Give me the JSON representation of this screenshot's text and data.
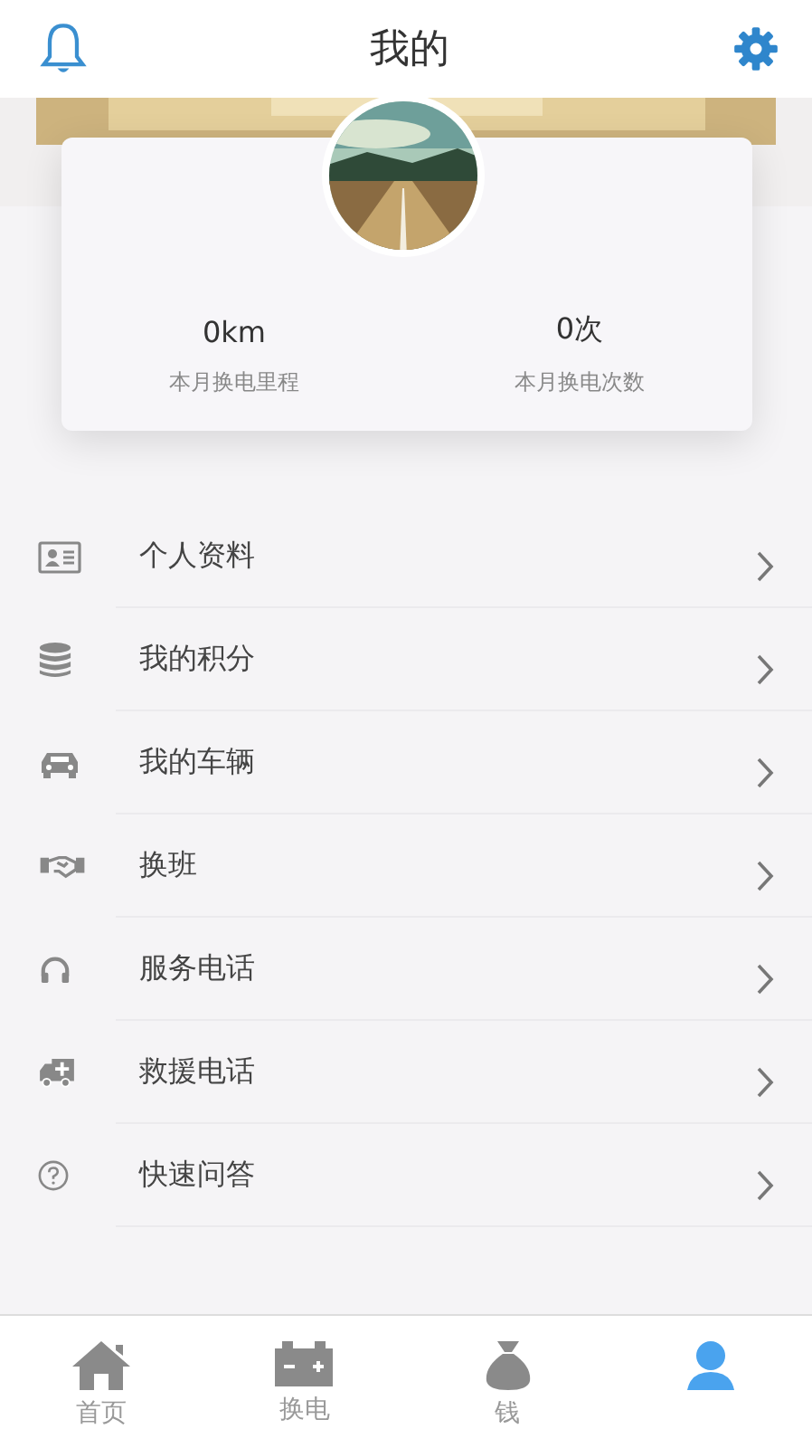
{
  "header": {
    "title": "我的"
  },
  "stats": [
    {
      "value": "0km",
      "label": "本月换电里程"
    },
    {
      "value": "0次",
      "label": "本月换电次数"
    }
  ],
  "menu": [
    {
      "label": "个人资料"
    },
    {
      "label": "我的积分"
    },
    {
      "label": "我的车辆"
    },
    {
      "label": "换班"
    },
    {
      "label": "服务电话"
    },
    {
      "label": "救援电话"
    },
    {
      "label": "快速问答"
    }
  ],
  "tabs": [
    {
      "label": "首页",
      "selected": false
    },
    {
      "label": "换电",
      "selected": false
    },
    {
      "label": "钱",
      "selected": false
    },
    {
      "selected": true
    }
  ]
}
